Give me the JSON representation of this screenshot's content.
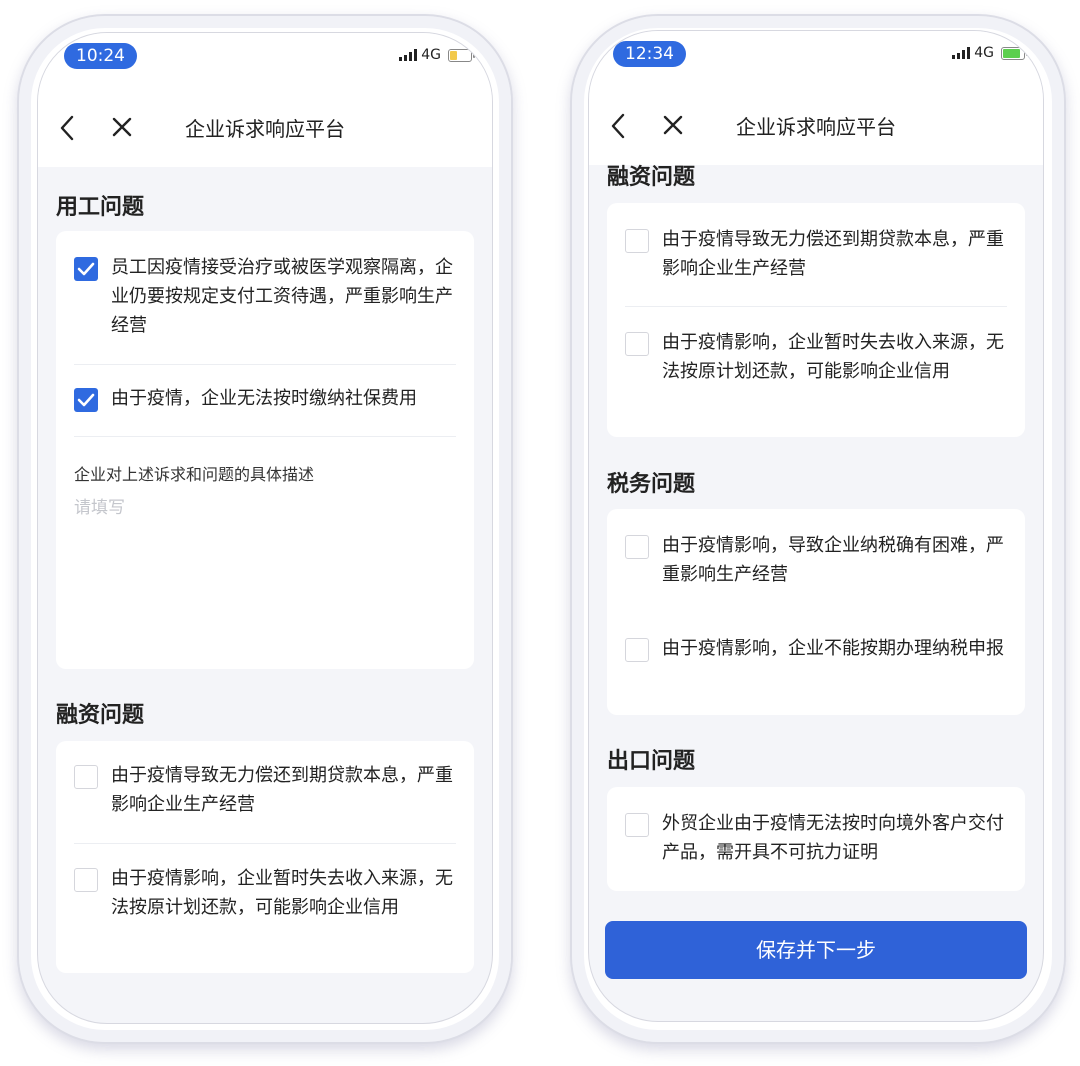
{
  "left": {
    "status": {
      "time": "10:24",
      "network": "4G"
    },
    "nav": {
      "title": "企业诉求响应平台"
    },
    "employment": {
      "title": "用工问题",
      "options": [
        {
          "text": "员工因疫情接受治疗或被医学观察隔离，企业仍要按规定支付工资待遇，严重影响生产经营",
          "checked": true
        },
        {
          "text": "由于疫情，企业无法按时缴纳社保费用",
          "checked": true
        }
      ],
      "description_label": "企业对上述诉求和问题的具体描述",
      "description_placeholder": "请填写"
    },
    "financing": {
      "title": "融资问题",
      "options": [
        {
          "text": "由于疫情导致无力偿还到期贷款本息，严重影响企业生产经营",
          "checked": false
        },
        {
          "text": "由于疫情影响，企业暂时失去收入来源，无法按原计划还款，可能影响企业信用",
          "checked": false
        }
      ]
    }
  },
  "right": {
    "status": {
      "time": "12:34",
      "network": "4G"
    },
    "nav": {
      "title": "企业诉求响应平台"
    },
    "financing": {
      "title": "融资问题",
      "options": [
        {
          "text": "由于疫情导致无力偿还到期贷款本息，严重影响企业生产经营",
          "checked": false
        },
        {
          "text": "由于疫情影响，企业暂时失去收入来源，无法按原计划还款，可能影响企业信用",
          "checked": false
        }
      ]
    },
    "tax": {
      "title": "税务问题",
      "options": [
        {
          "text": "由于疫情影响，导致企业纳税确有困难，严重影响生产经营",
          "checked": false
        },
        {
          "text": "由于疫情影响，企业不能按期办理纳税申报",
          "checked": false
        }
      ]
    },
    "export": {
      "title": "出口问题",
      "options": [
        {
          "text": "外贸企业由于疫情无法按时向境外客户交付产品，需开具不可抗力证明",
          "checked": false
        }
      ]
    },
    "save_button": "保存并下一步"
  },
  "colors": {
    "accent": "#2f6ae0",
    "button": "#2f62d8",
    "battery_left": "#f2c94c",
    "battery_right": "#5ccf4e"
  }
}
